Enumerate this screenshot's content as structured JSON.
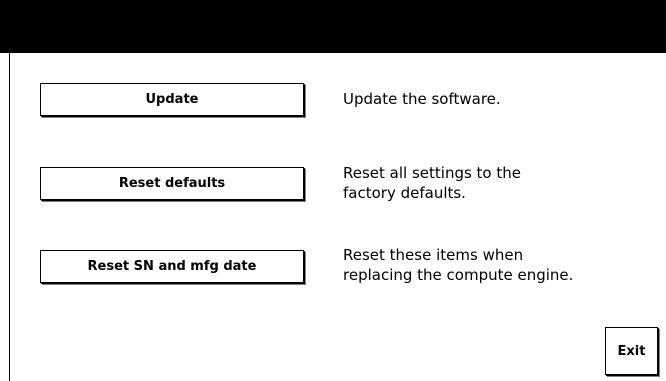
{
  "rows": [
    {
      "button_label": "Update",
      "description": [
        "Update the software."
      ]
    },
    {
      "button_label": "Reset defaults",
      "description": [
        "Reset all settings to the",
        "factory defaults."
      ]
    },
    {
      "button_label": "Reset SN and mfg date",
      "description": [
        "Reset these items when",
        "replacing the compute engine."
      ]
    }
  ],
  "exit_label": "Exit"
}
